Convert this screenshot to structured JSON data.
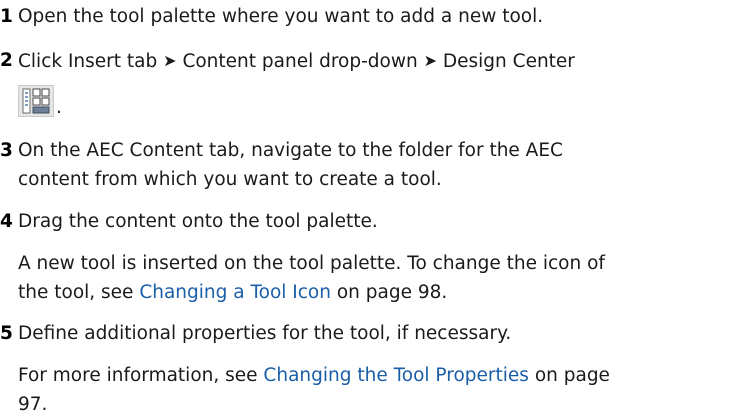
{
  "steps": [
    {
      "number": "1",
      "text": "Open the tool palette where you want to add a new tool."
    },
    {
      "number": "2",
      "part1": "Click Insert tab",
      "arrow": "➤",
      "part2": "Content panel drop-down",
      "part3": "Design Center",
      "icon": "design-center-icon",
      "trailing": "."
    },
    {
      "number": "3",
      "line1": "On the AEC Content tab, navigate to the folder for the AEC",
      "line2": "content from which you want to create a tool."
    },
    {
      "number": "4",
      "text": "Drag the content onto the tool palette.",
      "note_line1": "A new tool is inserted on the tool palette. To change the icon of",
      "note_line2_prefix": "the tool, see",
      "note_link": "Changing a Tool Icon",
      "note_line2_suffix": "on page 98."
    },
    {
      "number": "5",
      "text": "Define additional properties for the tool, if necessary.",
      "note_prefix": "For more information, see",
      "note_link": "Changing the Tool Properties",
      "note_suffix": "on page",
      "note_line2": "97."
    }
  ],
  "colors": {
    "link": "#1a5ea8",
    "text": "#1a1a1a"
  }
}
